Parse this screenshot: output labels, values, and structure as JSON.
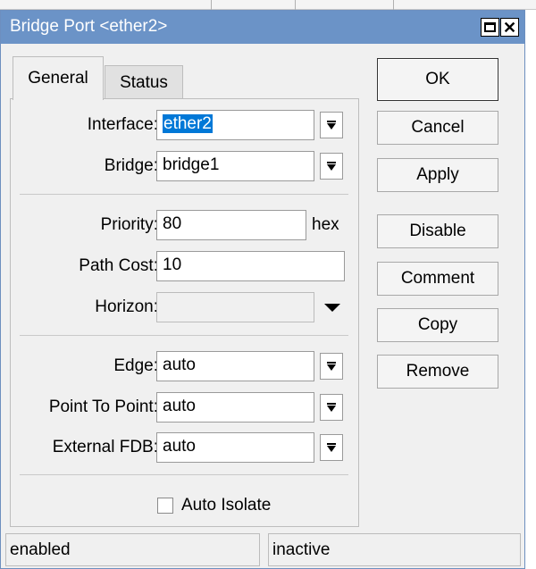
{
  "window": {
    "title": "Bridge Port <ether2>"
  },
  "tabs": [
    {
      "label": "General",
      "active": true
    },
    {
      "label": "Status",
      "active": false
    }
  ],
  "fields": {
    "interface": {
      "label": "Interface:",
      "value": "ether2"
    },
    "bridge": {
      "label": "Bridge:",
      "value": "bridge1"
    },
    "priority": {
      "label": "Priority:",
      "value": "80",
      "unit": "hex"
    },
    "path_cost": {
      "label": "Path Cost:",
      "value": "10"
    },
    "horizon": {
      "label": "Horizon:",
      "value": ""
    },
    "edge": {
      "label": "Edge:",
      "value": "auto"
    },
    "point_to_point": {
      "label": "Point To Point:",
      "value": "auto"
    },
    "external_fdb": {
      "label": "External FDB:",
      "value": "auto"
    },
    "auto_isolate": {
      "label": "Auto Isolate",
      "checked": false
    }
  },
  "buttons": {
    "ok": "OK",
    "cancel": "Cancel",
    "apply": "Apply",
    "disable": "Disable",
    "comment": "Comment",
    "copy": "Copy",
    "remove": "Remove"
  },
  "statusbar": {
    "left": "enabled",
    "right": "inactive"
  },
  "colors": {
    "titlebar": "#6b93c7",
    "selection": "#0078d7",
    "window_bg": "#f0f0f0"
  },
  "icons": [
    "maximize-icon",
    "close-icon",
    "dropdown-arrow-icon",
    "checkbox-icon"
  ]
}
